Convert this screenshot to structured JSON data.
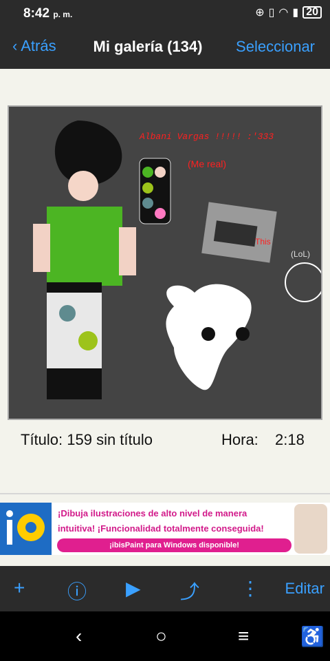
{
  "status": {
    "time": "8:42",
    "ampm": "p. m.",
    "battery": "20"
  },
  "nav": {
    "back_label": "Atrás",
    "title": "Mi galería (134)",
    "select_label": "Seleccionar"
  },
  "artwork": {
    "caption_red": "Albani Vargas !!!!! :'333",
    "caption_me": "(Me real)",
    "caption_this": "This",
    "caption_lol": "(LoL)"
  },
  "details": {
    "title_label": "Título: 159 sin título",
    "time_label": "Hora:",
    "time_value": "2:18"
  },
  "ad": {
    "line1": "¡Dibuja ilustraciones de alto nivel de manera",
    "line2": "intuitiva! ¡Funcionalidad totalmente conseguida!",
    "cta": "¡ibisPaint para Windows disponible!"
  },
  "toolbar": {
    "edit_label": "Editar"
  }
}
